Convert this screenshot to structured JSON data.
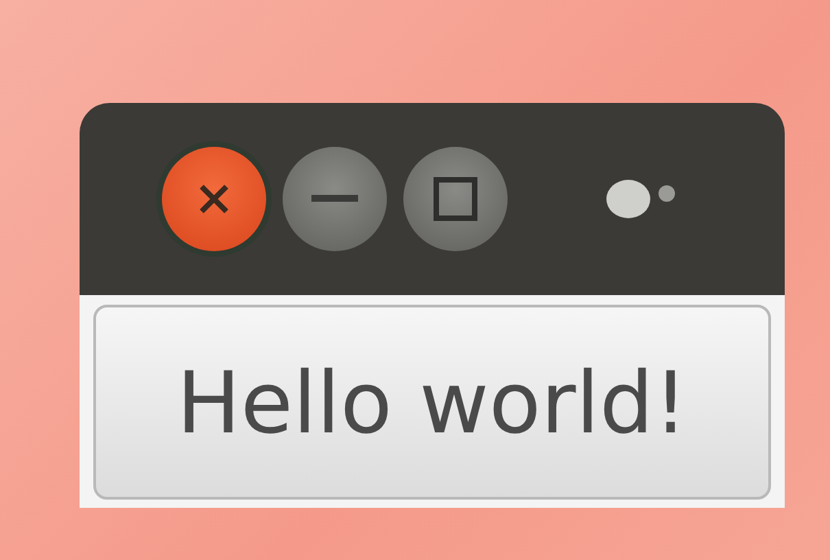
{
  "window": {
    "controls": [
      {
        "kind": "close"
      },
      {
        "kind": "minimize"
      },
      {
        "kind": "maximize"
      }
    ]
  },
  "button": {
    "label": "Hello world!"
  }
}
